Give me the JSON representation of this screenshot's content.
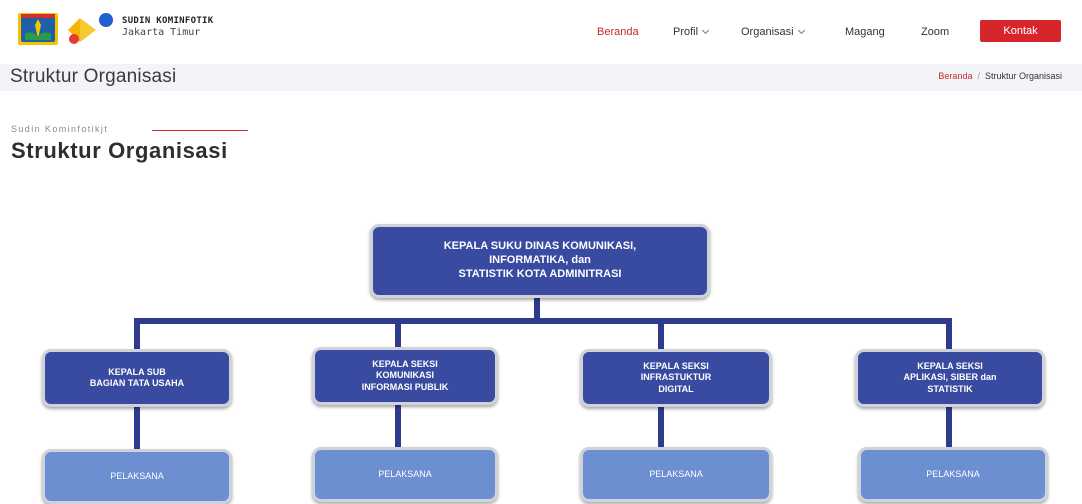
{
  "header": {
    "brand_name": "SUDIN KOMINFOTIK",
    "brand_sub": "Jakarta Timur",
    "nav": [
      {
        "label": "Beranda",
        "active": true,
        "dropdown": false
      },
      {
        "label": "Profil",
        "active": false,
        "dropdown": true
      },
      {
        "label": "Organisasi",
        "active": false,
        "dropdown": true
      },
      {
        "label": "Magang",
        "active": false,
        "dropdown": false
      },
      {
        "label": "Zoom",
        "active": false,
        "dropdown": false
      }
    ],
    "cta_label": "Kontak"
  },
  "titlebar": {
    "title": "Struktur Organisasi",
    "breadcrumb": [
      "Beranda",
      "Struktur Organisasi"
    ],
    "separator": "/"
  },
  "section": {
    "subtitle": "Sudin Kominfotikjt",
    "title": "Struktur Organisasi"
  },
  "org": {
    "head": "KEPALA SUKU DINAS KOMUNIKASI,\nINFORMATIKA, dan\nSTATISTIK KOTA ADMINITRASI",
    "units": [
      {
        "name": "KEPALA SUB\nBAGIAN TATA USAHA",
        "staff": "PELAKSANA"
      },
      {
        "name": "KEPALA SEKSI\nKOMUNIKASI\nINFORMASI PUBLIK",
        "staff": "PELAKSANA"
      },
      {
        "name": "KEPALA SEKSI\nINFRASTUKTUR\nDIGITAL",
        "staff": "PELAKSANA"
      },
      {
        "name": "KEPALA SEKSI\nAPLIKASI, SIBER dan\nSTATISTIK",
        "staff": "PELAKSANA"
      }
    ]
  },
  "colors": {
    "accent": "#d7262b",
    "org_dark": "#394aa1",
    "org_light": "#6b8fd0",
    "connector": "#2f3b8c"
  }
}
